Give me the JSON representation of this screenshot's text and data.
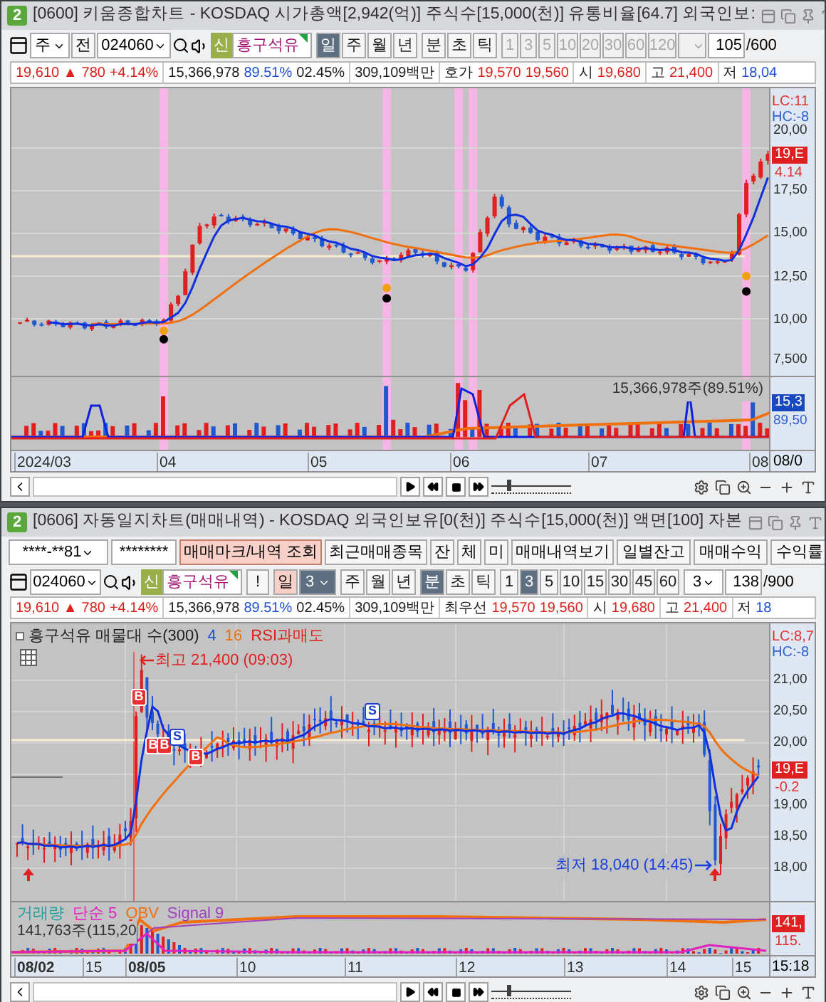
{
  "top_window": {
    "number": "2",
    "title": "[0600] 키움종합차트 - KOSDAQ 시가총액[2,942(억)] 주식수[15,000(천)] 유통비율[64.7] 외국인보:",
    "toolbar": {
      "market": "주",
      "prefix": "전",
      "code": "024060",
      "stock_badge": "신",
      "stock_name": "흥구석유",
      "periods": [
        {
          "label": "일",
          "selected": true
        },
        {
          "label": "주",
          "selected": false
        },
        {
          "label": "월",
          "selected": false
        },
        {
          "label": "년",
          "selected": false
        }
      ],
      "units": [
        {
          "label": "분",
          "selected": false
        },
        {
          "label": "초",
          "selected": false
        },
        {
          "label": "틱",
          "selected": false
        }
      ],
      "intervals": [
        {
          "label": "1",
          "disabled": true
        },
        {
          "label": "3",
          "disabled": true
        },
        {
          "label": "5",
          "disabled": true
        },
        {
          "label": "10",
          "disabled": true
        },
        {
          "label": "20",
          "disabled": true
        },
        {
          "label": "30",
          "disabled": true
        },
        {
          "label": "60",
          "disabled": true
        },
        {
          "label": "120",
          "disabled": true
        }
      ],
      "count": "105",
      "total": "/600"
    },
    "quote": [
      [
        {
          "text": "19,610 ▲",
          "color": "#e0201a"
        },
        {
          "text": "780",
          "color": "#e0201a"
        },
        {
          "text": "+4.14%",
          "color": "#e0201a"
        }
      ],
      [
        {
          "text": "15,366,978",
          "color": "#202020"
        },
        {
          "text": "89.51%",
          "color": "#1e4fd8"
        },
        {
          "text": "02.45%",
          "color": "#202020"
        }
      ],
      [
        {
          "text": "309,109백만",
          "color": "#202020"
        }
      ],
      [
        {
          "text": "호가",
          "color": "#202020"
        },
        {
          "text": "19,570",
          "color": "#e0201a"
        },
        {
          "text": "19,560",
          "color": "#e0201a"
        }
      ],
      [
        {
          "text": "시",
          "color": "#202020"
        },
        {
          "text": "19,680",
          "color": "#e0201a"
        }
      ],
      [
        {
          "text": "고",
          "color": "#202020"
        },
        {
          "text": "21,400",
          "color": "#e0201a"
        }
      ],
      [
        {
          "text": "저",
          "color": "#202020"
        },
        {
          "text": "18,04",
          "color": "#1e4fd8"
        }
      ]
    ],
    "price_axis": {
      "lc": "LC:11",
      "hc": "HC:-8",
      "ticks": [
        "20,00",
        "17,50",
        "15,00",
        "12,50",
        "10,00",
        "7,500"
      ],
      "price_badge": "19,E",
      "change": "4.14"
    },
    "volume_panel": {
      "label": "15,366,978주(89.51%)",
      "badge": "15,3",
      "reading": "89,50"
    },
    "date_axis": [
      "2024/03",
      "04",
      "05",
      "06",
      "07",
      "08"
    ],
    "date_end": "08/0",
    "zoom_slider": {
      "level": 0.2
    }
  },
  "bottom_window": {
    "number": "2",
    "title": "[0606] 자동일지차트(매매내역) - KOSDAQ 외국인보유[0(천)] 주식수[15,000(천)] 액면[100] 자본",
    "account": {
      "number": "****-**81",
      "password": "********"
    },
    "actions": [
      {
        "label": "매매마크/내역 조회",
        "selected": true
      },
      {
        "label": "최근매매종목",
        "selected": false
      },
      {
        "label": "잔",
        "selected": false
      },
      {
        "label": "체",
        "selected": false
      },
      {
        "label": "미",
        "selected": false
      },
      {
        "label": "매매내역보기",
        "selected": false
      }
    ],
    "right_actions": [
      "일별잔고",
      "매매수익",
      "수익률"
    ],
    "toolbar": {
      "code": "024060",
      "stock_badge": "신",
      "stock_name": "흥구석유",
      "alert": "!",
      "day": {
        "label": "일",
        "selected": true
      },
      "day_count": "3",
      "periods": [
        {
          "label": "주",
          "selected": false
        },
        {
          "label": "월",
          "selected": false
        },
        {
          "label": "년",
          "selected": false
        }
      ],
      "units": [
        {
          "label": "분",
          "selected": true
        },
        {
          "label": "초",
          "selected": false
        },
        {
          "label": "틱",
          "selected": false
        }
      ],
      "intervals": [
        {
          "label": "1",
          "selected": false
        },
        {
          "label": "3",
          "selected": true
        },
        {
          "label": "5",
          "selected": false
        },
        {
          "label": "10",
          "selected": false
        },
        {
          "label": "15",
          "selected": false
        },
        {
          "label": "30",
          "selected": false
        },
        {
          "label": "45",
          "selected": false
        },
        {
          "label": "60",
          "selected": false
        }
      ],
      "interval_count": "3",
      "count": "138",
      "total": "/900"
    },
    "quote": [
      [
        {
          "text": "19,610 ▲",
          "color": "#e0201a"
        },
        {
          "text": "780",
          "color": "#e0201a"
        },
        {
          "text": "+4.14%",
          "color": "#e0201a"
        }
      ],
      [
        {
          "text": "15,366,978",
          "color": "#202020"
        },
        {
          "text": "89.51%",
          "color": "#1e4fd8"
        },
        {
          "text": "02.45%",
          "color": "#202020"
        }
      ],
      [
        {
          "text": "309,109백만",
          "color": "#202020"
        }
      ],
      [
        {
          "text": "최우선",
          "color": "#202020"
        },
        {
          "text": "19,570",
          "color": "#e0201a"
        },
        {
          "text": "19,560",
          "color": "#e0201a"
        }
      ],
      [
        {
          "text": "시",
          "color": "#202020"
        },
        {
          "text": "19,680",
          "color": "#e0201a"
        }
      ],
      [
        {
          "text": "고",
          "color": "#202020"
        },
        {
          "text": "21,400",
          "color": "#e0201a"
        }
      ],
      [
        {
          "text": "저",
          "color": "#202020"
        },
        {
          "text": "18",
          "color": "#1e4fd8"
        }
      ]
    ],
    "legend": [
      {
        "text": "흥구석유 매물대 수(300)",
        "color": "#202020"
      },
      {
        "text": "4",
        "color": "#1e4fd8"
      },
      {
        "text": "16",
        "color": "#f07010"
      },
      {
        "text": "RSI과매도",
        "color": "#e0201a"
      }
    ],
    "high_note": "최고 21,400 (09:03)",
    "low_note": "최저 18,040 (14:45)",
    "trade_marks": [
      {
        "label": "B",
        "kind": "buy"
      },
      {
        "label": "B",
        "kind": "buy"
      },
      {
        "label": "B",
        "kind": "buy"
      },
      {
        "label": "S",
        "kind": "sell"
      },
      {
        "label": "B",
        "kind": "buy"
      },
      {
        "label": "S",
        "kind": "sell"
      }
    ],
    "price_axis": {
      "lc": "LC:8,7",
      "hc": "HC:-8",
      "ticks": [
        "21,00",
        "20,50",
        "20,00",
        "19,00",
        "18,50",
        "18,00"
      ],
      "price_badge": "19,E",
      "change": "-0.2"
    },
    "lower_legend": [
      {
        "text": "거래량",
        "color": "#1fa0a0"
      },
      {
        "text": "단순 5",
        "color": "#e020c0"
      },
      {
        "text": "OBV",
        "color": "#f07010"
      },
      {
        "text": "Signal 9",
        "color": "#a040c0"
      }
    ],
    "lower_reading": "141,763주(115,20",
    "lower_badge": "141,",
    "lower_value": "115.",
    "date_axis": [
      "08/02",
      "15",
      "08/05",
      "10",
      "11",
      "12",
      "13",
      "14",
      "15"
    ],
    "date_end": "15:18",
    "zoom_slider": {
      "level": 0.2
    }
  }
}
